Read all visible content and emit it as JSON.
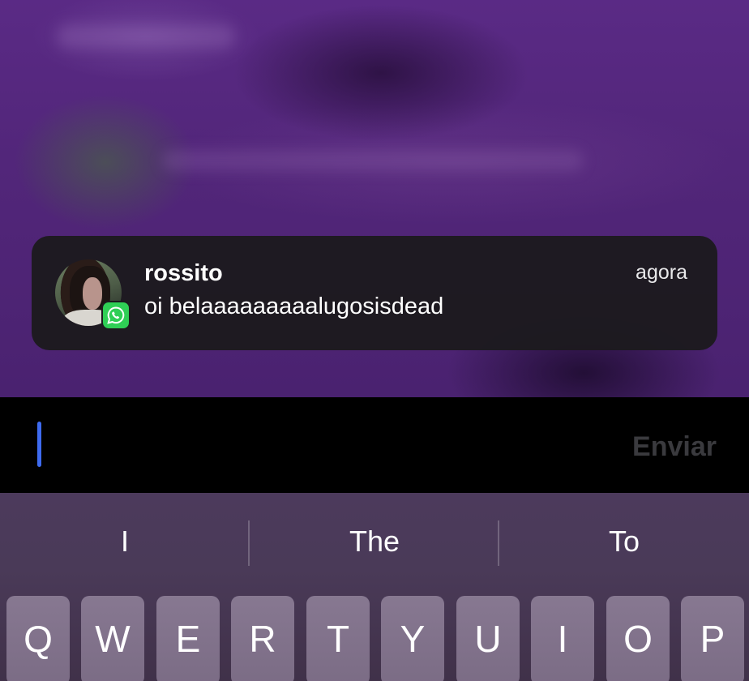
{
  "notification": {
    "sender": "rossito",
    "time": "agora",
    "message": "oi belaaaaaaaaalugosisdead",
    "app_icon": "whatsapp-icon",
    "badge_color": "#2fcf55"
  },
  "reply": {
    "send_label": "Enviar",
    "caret_color": "#3e6bf0"
  },
  "keyboard": {
    "suggestions": [
      "I",
      "The",
      "To"
    ],
    "row1": [
      "Q",
      "W",
      "E",
      "R",
      "T",
      "Y",
      "U",
      "I",
      "O",
      "P"
    ]
  }
}
